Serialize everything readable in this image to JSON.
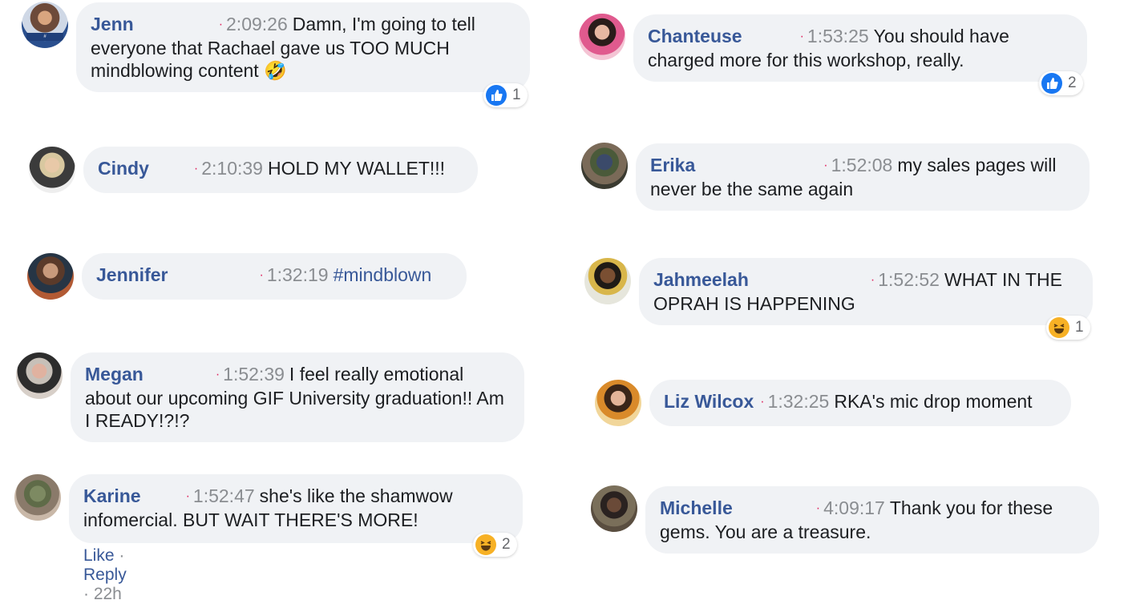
{
  "comments": [
    {
      "author": "Jenn",
      "time": "2:09:26",
      "text": "Damn, I'm going to tell everyone that Rachael gave us TOO MUCH mindblowing content",
      "emoji": "🤣",
      "reaction": {
        "type": "like",
        "count": "1"
      }
    },
    {
      "author": "Cindy",
      "time": "2:10:39",
      "text": "HOLD MY WALLET!!!"
    },
    {
      "author": "Jennifer",
      "time": "1:32:19",
      "text": "#mindblown"
    },
    {
      "author": "Megan",
      "time": "1:52:39",
      "text": "I feel really emotional about our upcoming GIF University graduation!! Am I READY!?!?"
    },
    {
      "author": "Karine",
      "time": "1:52:47",
      "text": "she's like the shamwow infomercial. BUT WAIT THERE'S MORE!",
      "reaction": {
        "type": "haha",
        "count": "2"
      }
    },
    {
      "author": "Chanteuse",
      "time": "1:53:25",
      "text": "You should have charged more for this workshop, really.",
      "reaction": {
        "type": "like",
        "count": "2"
      }
    },
    {
      "author": "Erika",
      "time": "1:52:08",
      "text": "my sales pages will never be the same again"
    },
    {
      "author": "Jahmeelah",
      "time": "1:52:52",
      "text": "WHAT IN THE OPRAH IS HAPPENING",
      "reaction": {
        "type": "haha",
        "count": "1"
      }
    },
    {
      "author": "Liz Wilcox",
      "time": "1:32:25",
      "text": "RKA's mic drop moment"
    },
    {
      "author": "Michelle",
      "time": "4:09:17",
      "text": "Thank you for these gems. You are a treasure."
    }
  ],
  "actions": {
    "like": "Like",
    "sep1": " · ",
    "reply": "Reply",
    "sep2": " · ",
    "age": "22h"
  },
  "colors": {
    "author": "#385898",
    "bubble": "#f0f2f5",
    "timestamp": "#8a8d91",
    "dot": "#e0245e",
    "like_blue": "#1877f2",
    "haha_yellow": "#f7b125"
  },
  "icons": {
    "like_reaction": "thumbs-up-icon",
    "haha_reaction": "laughing-face-icon"
  }
}
